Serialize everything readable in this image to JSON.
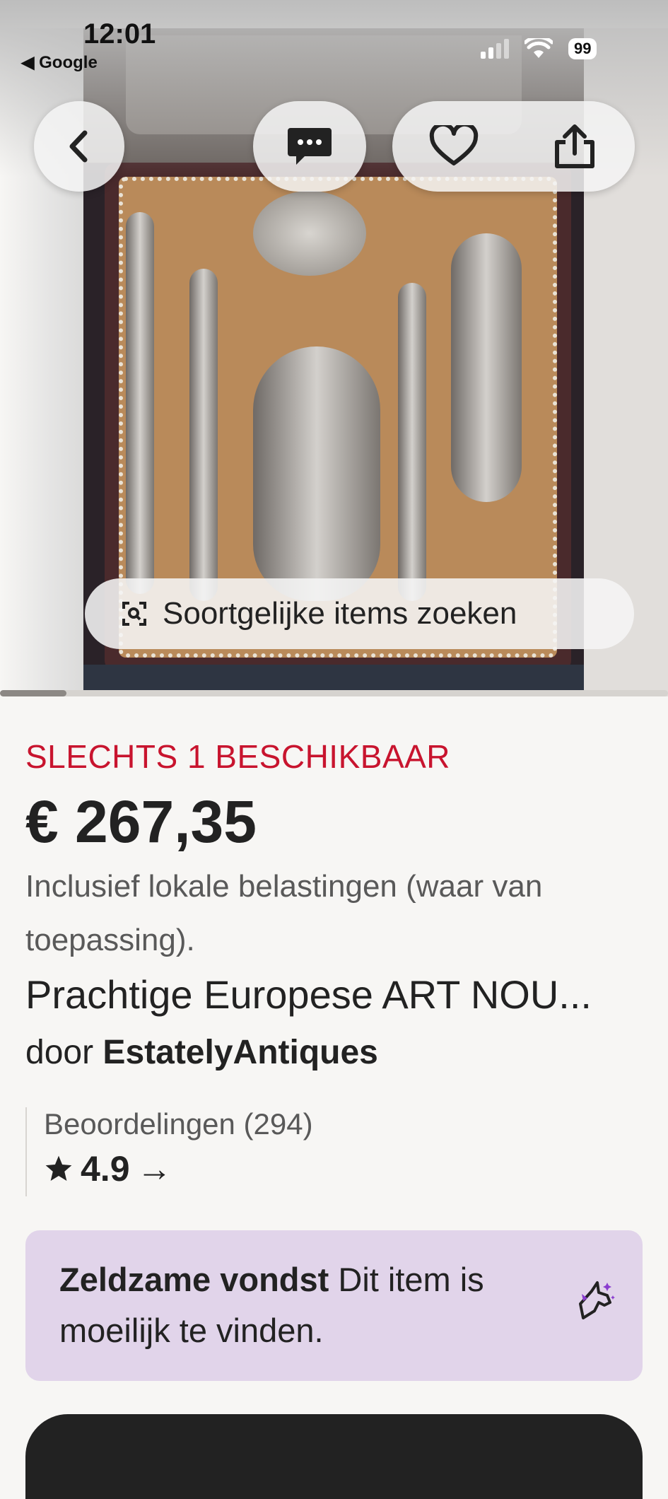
{
  "status_bar": {
    "time": "12:01",
    "back_app": "◀ Google",
    "battery": "99"
  },
  "hero": {
    "find_similar_label": "Soortgelijke items zoeken"
  },
  "listing": {
    "availability": "SLECHTS 1 BESCHIKBAAR",
    "price": "€ 267,35",
    "tax_note": "Inclusief lokale belastingen (waar van toepassing).",
    "title": "Prachtige Europese ART NOU...",
    "seller_prefix": "door",
    "seller_name": "EstatelyAntiques",
    "reviews_label": "Beoordelingen (294)",
    "rating": "4.9",
    "rating_arrow": "→",
    "rare_title": "Zeldzame vondst",
    "rare_text": "Dit item is moeilijk te vinden."
  },
  "colors": {
    "availability": "#c8142e",
    "rare_bg": "#e1d4ea",
    "background": "#f7f6f4"
  },
  "icons": [
    "back-chevron-icon",
    "message-icon",
    "heart-icon",
    "share-icon",
    "visual-search-icon",
    "star-icon",
    "unicorn-icon"
  ]
}
